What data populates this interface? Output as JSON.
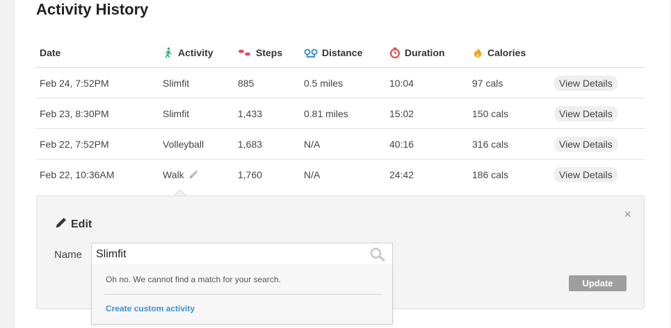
{
  "page_title": "Activity History",
  "columns": {
    "date": "Date",
    "activity": "Activity",
    "steps": "Steps",
    "distance": "Distance",
    "duration": "Duration",
    "calories": "Calories"
  },
  "icons": {
    "activity": "walking-person-icon",
    "steps": "footprints-icon",
    "distance": "distance-pins-icon",
    "duration": "stopwatch-icon",
    "calories": "flame-icon"
  },
  "colors": {
    "activity_icon": "#2bb673",
    "steps_icon": "#e8456b",
    "distance_icon": "#3a8fd8",
    "duration_icon": "#e24040",
    "calories_icon": "#f39c12",
    "link": "#3d8fd1"
  },
  "rows": [
    {
      "date": "Feb 24, 7:52PM",
      "activity": "Slimfit",
      "steps": "885",
      "distance": "0.5 miles",
      "duration": "10:04",
      "calories": "97 cals",
      "action": "View Details"
    },
    {
      "date": "Feb 23, 8:30PM",
      "activity": "Slimfit",
      "steps": "1,433",
      "distance": "0.81 miles",
      "duration": "15:02",
      "calories": "150 cals",
      "action": "View Details"
    },
    {
      "date": "Feb 22, 7:52PM",
      "activity": "Volleyball",
      "steps": "1,683",
      "distance": "N/A",
      "duration": "40:16",
      "calories": "316 cals",
      "action": "View Details"
    },
    {
      "date": "Feb 22, 10:36AM",
      "activity": "Walk",
      "steps": "1,760",
      "distance": "N/A",
      "duration": "24:42",
      "calories": "186 cals",
      "action": "View Details"
    }
  ],
  "edit": {
    "title": "Edit",
    "name_label": "Name",
    "name_value": "Slimfit",
    "update_label": "Update",
    "close_label": "×",
    "no_match_text": "Oh no. We cannot find a match for your search.",
    "create_link": "Create custom activity"
  }
}
